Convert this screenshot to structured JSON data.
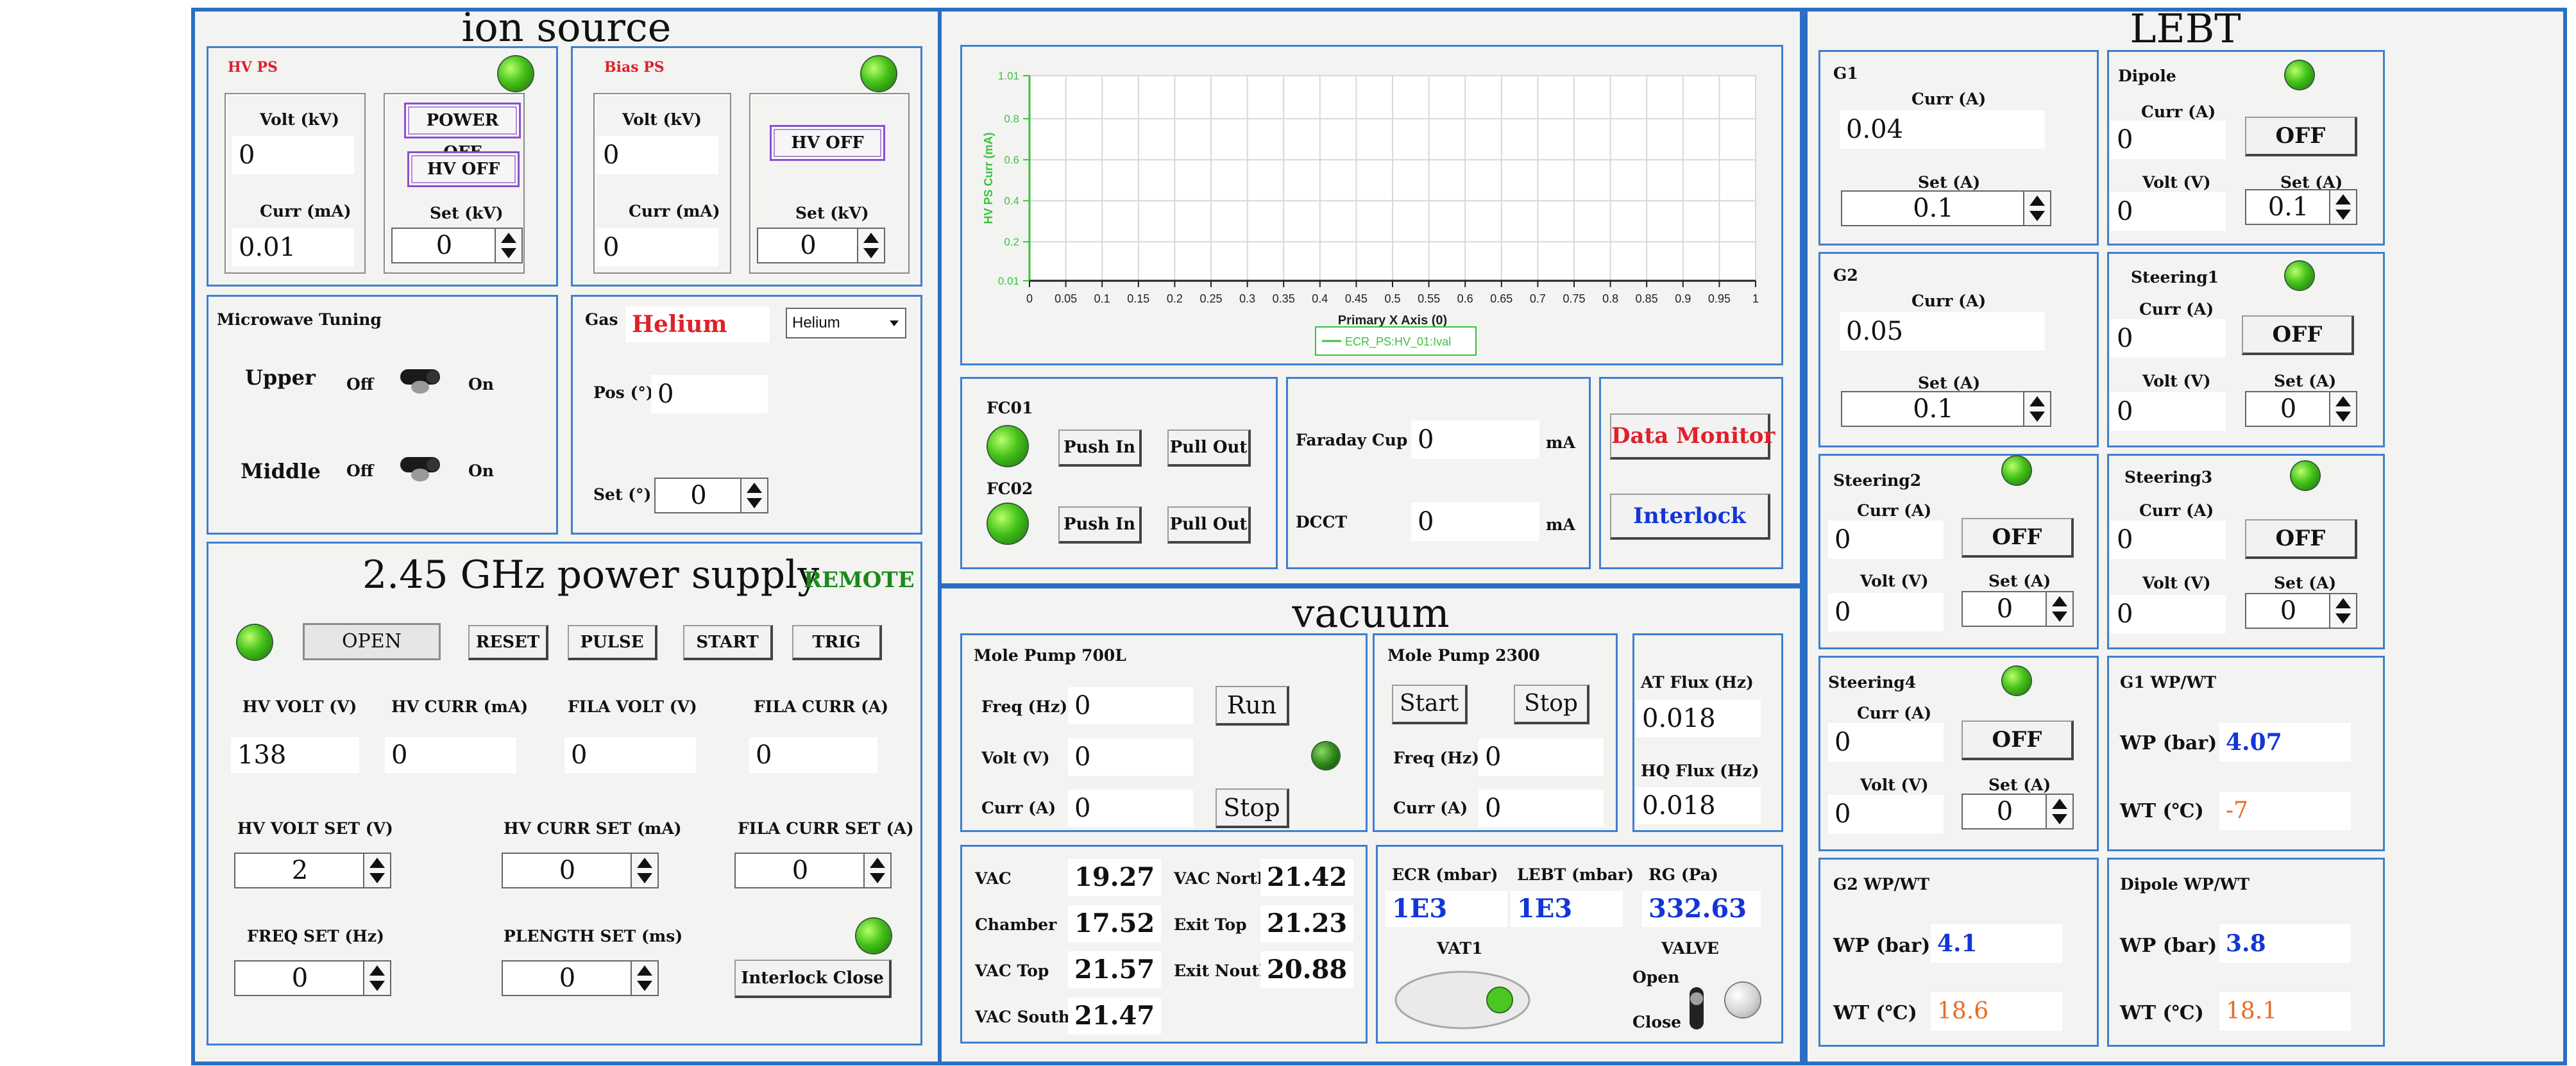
{
  "ion_source": {
    "title": "ion source",
    "hvps": {
      "title": "HV PS",
      "volt_label": "Volt (kV)",
      "volt": "0",
      "curr_label": "Curr (mA)",
      "curr": "0.01",
      "power_btn": "POWER OFF",
      "hv_btn": "HV OFF",
      "set_label": "Set (kV)",
      "set": "0"
    },
    "biasps": {
      "title": "Bias PS",
      "volt_label": "Volt (kV)",
      "volt": "0",
      "curr_label": "Curr (mA)",
      "curr": "0",
      "hv_btn": "HV OFF",
      "set_label": "Set (kV)",
      "set": "0"
    },
    "microwave": {
      "title": "Microwave Tuning",
      "upper": "Upper",
      "middle": "Middle",
      "off": "Off",
      "on": "On"
    },
    "gas": {
      "title": "Gas",
      "value": "Helium",
      "select": "Helium",
      "pos_label": "Pos (°)",
      "pos": "0",
      "set_label": "Set (°)",
      "set": "0"
    }
  },
  "ps245": {
    "title": "2.45 GHz power supply",
    "remote": "REMOTE",
    "open": "OPEN",
    "reset": "RESET",
    "pulse": "PULSE",
    "start": "START",
    "trig": "TRIG",
    "hv_volt_label": "HV VOLT (V)",
    "hv_volt": "138",
    "hv_curr_label": "HV CURR (mA)",
    "hv_curr": "0",
    "fila_volt_label": "FILA VOLT (V)",
    "fila_volt": "0",
    "fila_curr_label": "FILA CURR (A)",
    "fila_curr": "0",
    "hv_volt_set_label": "HV VOLT SET (V)",
    "hv_volt_set": "2",
    "hv_curr_set_label": "HV CURR SET (mA)",
    "hv_curr_set": "0",
    "fila_curr_set_label": "FILA CURR SET (A)",
    "fila_curr_set": "0",
    "freq_set_label": "FREQ SET (Hz)",
    "freq_set": "0",
    "plength_set_label": "PLENGTH SET (ms)",
    "plength_set": "0",
    "interlock_close": "Interlock Close"
  },
  "chart_data": {
    "type": "line",
    "title": "",
    "xlabel": "Primary X Axis (0)",
    "ylabel": "HV PS Curr (mA)",
    "xlim": [
      0,
      1
    ],
    "ylim": [
      0.01,
      1.01
    ],
    "xticks": [
      "0",
      "0.05",
      "0.1",
      "0.15",
      "0.2",
      "0.25",
      "0.3",
      "0.35",
      "0.4",
      "0.45",
      "0.5",
      "0.55",
      "0.6",
      "0.65",
      "0.7",
      "0.75",
      "0.8",
      "0.85",
      "0.9",
      "0.95",
      "1"
    ],
    "yticks": [
      "0.01",
      "0.2",
      "0.4",
      "0.6",
      "0.8",
      "1.01"
    ],
    "grid": true,
    "legend": "bottom-center",
    "series": [
      {
        "name": "ECR_PS:HV_01:Ival",
        "values": []
      }
    ],
    "color": "#3cc23c"
  },
  "fc": {
    "fc01": "FC01",
    "fc02": "FC02",
    "push_in": "Push In",
    "pull_out": "Pull Out"
  },
  "meas": {
    "faraday_label": "Faraday Cup",
    "faraday": "0",
    "faraday_unit": "mA",
    "dcct_label": "DCCT",
    "dcct": "0",
    "dcct_unit": "mA"
  },
  "actions": {
    "data_monitor": "Data Monitor",
    "interlock": "Interlock"
  },
  "vacuum": {
    "title": "vacuum",
    "mp700": {
      "title": "Mole Pump 700L",
      "freq_label": "Freq (Hz)",
      "freq": "0",
      "volt_label": "Volt (V)",
      "volt": "0",
      "curr_label": "Curr (A)",
      "curr": "0",
      "run": "Run",
      "stop": "Stop"
    },
    "mp2300": {
      "title": "Mole Pump 2300",
      "start": "Start",
      "stop": "Stop",
      "freq_label": "Freq (Hz)",
      "freq": "0",
      "curr_label": "Curr (A)",
      "curr": "0"
    },
    "flux": {
      "at_label": "AT Flux (Hz)",
      "at": "0.018",
      "hq_label": "HQ Flux (Hz)",
      "hq": "0.018"
    },
    "readings": {
      "vac_label": "VAC",
      "vac": "19.27",
      "chamber_label": "Chamber",
      "chamber": "17.52",
      "vac_top_label": "VAC Top",
      "vac_top": "21.57",
      "vac_south_label": "VAC South",
      "vac_south": "21.47",
      "vac_north_label": "VAC North",
      "vac_north": "21.42",
      "exit_top_label": "Exit Top",
      "exit_top": "21.23",
      "exit_nouth_label": "Exit Nouth",
      "exit_nouth": "20.88"
    },
    "gauges": {
      "ecr_label": "ECR (mbar)",
      "ecr": "1E3",
      "lebt_label": "LEBT (mbar)",
      "lebt": "1E3",
      "rg_label": "RG (Pa)",
      "rg": "332.63",
      "vat_label": "VAT1",
      "valve_label": "VALVE",
      "open": "Open",
      "close": "Close"
    }
  },
  "lebt": {
    "title": "LEBT",
    "g1": {
      "title": "G1",
      "curr_label": "Curr (A)",
      "curr": "0.04",
      "set_label": "Set (A)",
      "set": "0.1"
    },
    "g2": {
      "title": "G2",
      "curr_label": "Curr (A)",
      "curr": "0.05",
      "set_label": "Set (A)",
      "set": "0.1"
    },
    "dipole": {
      "title": "Dipole",
      "curr_label": "Curr (A)",
      "curr": "0",
      "off": "OFF",
      "volt_label": "Volt (V)",
      "volt": "0",
      "set_label": "Set (A)",
      "set": "0.1"
    },
    "steering1": {
      "title": "Steering1",
      "curr_label": "Curr (A)",
      "curr": "0",
      "off": "OFF",
      "volt_label": "Volt (V)",
      "volt": "0",
      "set_label": "Set (A)",
      "set": "0"
    },
    "steering2": {
      "title": "Steering2",
      "curr_label": "Curr (A)",
      "curr": "0",
      "off": "OFF",
      "volt_label": "Volt (V)",
      "volt": "0",
      "set_label": "Set (A)",
      "set": "0"
    },
    "steering3": {
      "title": "Steering3",
      "curr_label": "Curr (A)",
      "curr": "0",
      "off": "OFF",
      "volt_label": "Volt (V)",
      "volt": "0",
      "set_label": "Set (A)",
      "set": "0"
    },
    "steering4": {
      "title": "Steering4",
      "curr_label": "Curr (A)",
      "curr": "0",
      "off": "OFF",
      "volt_label": "Volt (V)",
      "volt": "0",
      "set_label": "Set (A)",
      "set": "0"
    },
    "g1wp": {
      "title": "G1 WP/WT",
      "wp_label": "WP (bar)",
      "wp": "4.07",
      "wt_label": "WT (℃)",
      "wt": "-7"
    },
    "g2wp": {
      "title": "G2 WP/WT",
      "wp_label": "WP (bar)",
      "wp": "4.1",
      "wt_label": "WT (℃)",
      "wt": "18.6"
    },
    "dipolewp": {
      "title": "Dipole WP/WT",
      "wp_label": "WP (bar)",
      "wp": "3.8",
      "wt_label": "WT (℃)",
      "wt": "18.1"
    }
  }
}
